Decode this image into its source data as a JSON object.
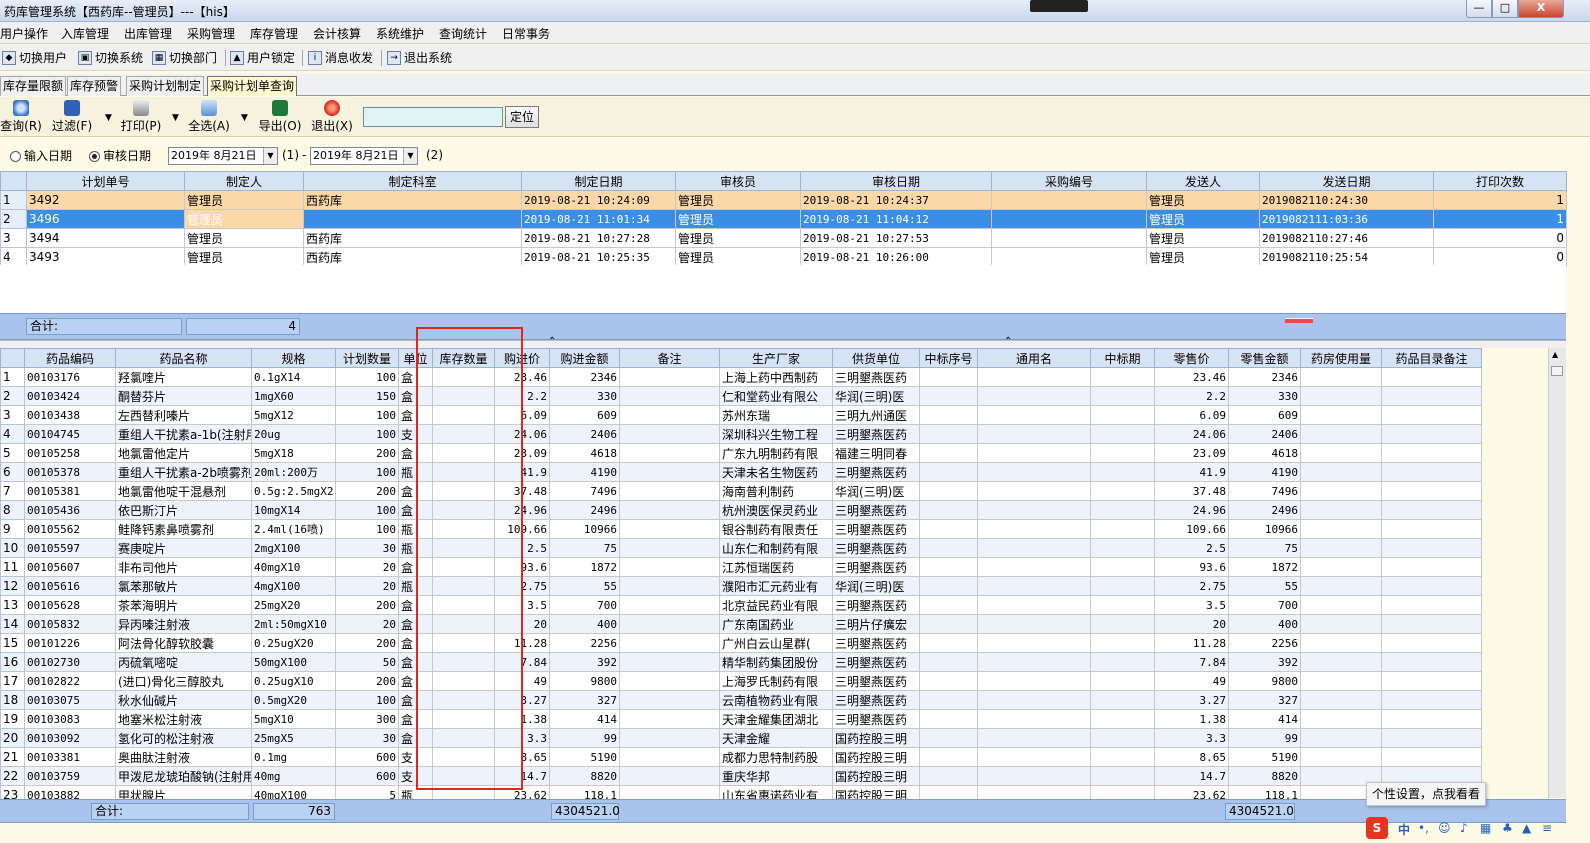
{
  "window": {
    "title": "药库管理系统【西药库--管理员】---【his】",
    "min_label": "—",
    "max_label": "□",
    "close_label": "X"
  },
  "menu": [
    "用户操作",
    "入库管理",
    "出库管理",
    "采购管理",
    "库存管理",
    "会计核算",
    "系统维护",
    "查询统计",
    "日常事务"
  ],
  "quickbar": [
    "切换用户",
    "切换系统",
    "切换部门",
    "用户锁定",
    "消息收发",
    "退出系统"
  ],
  "tabs": [
    "库存量限额",
    "库存预警",
    "采购计划制定",
    "采购计划单查询"
  ],
  "functions": {
    "query": "查询(R)",
    "filter": "过滤(F)",
    "print": "打印(P)",
    "select_all": "全选(A)",
    "export": "导出(O)",
    "exit": "退出(X)",
    "locate_button": "定位",
    "locate_value": ""
  },
  "filter": {
    "input_date_label": "输入日期",
    "audit_date_label": "审核日期",
    "date_from": "2019年 8月21日",
    "label_1": "(1)",
    "separator": "-",
    "date_to": "2019年 8月21日",
    "label_2": "(2)"
  },
  "plans": {
    "headers": [
      "计划单号",
      "制定人",
      "制定科室",
      "制定日期",
      "审核员",
      "审核日期",
      "采购编号",
      "发送人",
      "发送日期",
      "打印次数"
    ],
    "rows": [
      [
        "1",
        "3492",
        "管理员",
        "西药库",
        "2019-08-21 10:24:09",
        "管理员",
        "2019-08-21 10:24:37",
        "",
        "管理员",
        "2019082110:24:30",
        "1"
      ],
      [
        "2",
        "3496",
        "管理员",
        "",
        "2019-08-21 11:01:34",
        "管理员",
        "2019-08-21 11:04:12",
        "",
        "管理员",
        "2019082111:03:36",
        "1"
      ],
      [
        "3",
        "3494",
        "管理员",
        "西药库",
        "2019-08-21 10:27:28",
        "管理员",
        "2019-08-21 10:27:53",
        "",
        "管理员",
        "2019082110:27:46",
        "0"
      ],
      [
        "4",
        "3493",
        "管理员",
        "西药库",
        "2019-08-21 10:25:35",
        "管理员",
        "2019-08-21 10:26:00",
        "",
        "管理员",
        "2019082110:25:54",
        "0"
      ]
    ],
    "summary_label": "合计:",
    "summary_count": "4"
  },
  "details": {
    "headers": [
      "药品编码",
      "药品名称",
      "规格",
      "计划数量",
      "单位",
      "库存数量",
      "购进价",
      "购进金额",
      "备注",
      "生产厂家",
      "供货单位",
      "中标序号",
      "通用名",
      "中标期",
      "零售价",
      "零售金额",
      "药房使用量",
      "药品目录备注"
    ],
    "rows": [
      [
        "1",
        "00103176",
        "羟氯喹片",
        "0.1gX14",
        "100",
        "盒",
        "",
        "23.46",
        "2346",
        "",
        "上海上药中西制药",
        "三明墾燕医药",
        "",
        "",
        "",
        "23.46",
        "2346",
        "",
        ""
      ],
      [
        "2",
        "00103424",
        "酮替芬片",
        "1mgX60",
        "150",
        "盒",
        "",
        "2.2",
        "330",
        "",
        "仁和堂药业有限公",
        "华润(三明)医",
        "",
        "",
        "",
        "2.2",
        "330",
        "",
        ""
      ],
      [
        "3",
        "00103438",
        "左西替利嗪片",
        "5mgX12",
        "100",
        "盒",
        "",
        "6.09",
        "609",
        "",
        "苏州东瑞",
        "三明九州通医",
        "",
        "",
        "",
        "6.09",
        "609",
        "",
        ""
      ],
      [
        "4",
        "00104745",
        "重组人干扰素a-1b(注射用",
        "20ug",
        "100",
        "支",
        "",
        "24.06",
        "2406",
        "",
        "深圳科兴生物工程",
        "三明墾燕医药",
        "",
        "",
        "",
        "24.06",
        "2406",
        "",
        ""
      ],
      [
        "5",
        "00105258",
        "地氯雷他定片",
        "5mgX18",
        "200",
        "盒",
        "",
        "23.09",
        "4618",
        "",
        "广东九明制药有限",
        "福建三明同春",
        "",
        "",
        "",
        "23.09",
        "4618",
        "",
        ""
      ],
      [
        "6",
        "00105378",
        "重组人干扰素a-2b喷雾剂",
        "20ml:200万",
        "100",
        "瓶",
        "",
        "41.9",
        "4190",
        "",
        "天津未名生物医药",
        "三明墾燕医药",
        "",
        "",
        "",
        "41.9",
        "4190",
        "",
        ""
      ],
      [
        "7",
        "00105381",
        "地氯雷他啶干混悬剂",
        "0.5g:2.5mgX2",
        "200",
        "盒",
        "",
        "37.48",
        "7496",
        "",
        "海南普利制药",
        "华润(三明)医",
        "",
        "",
        "",
        "37.48",
        "7496",
        "",
        ""
      ],
      [
        "8",
        "00105436",
        "依巴斯汀片",
        "10mgX14",
        "100",
        "盒",
        "",
        "24.96",
        "2496",
        "",
        "杭州澳医保灵药业",
        "三明墾燕医药",
        "",
        "",
        "",
        "24.96",
        "2496",
        "",
        ""
      ],
      [
        "9",
        "00105562",
        "鲑降钙素鼻喷雾剂",
        "2.4ml(16喷)",
        "100",
        "瓶",
        "",
        "109.66",
        "10966",
        "",
        "银谷制药有限责任",
        "三明墾燕医药",
        "",
        "",
        "",
        "109.66",
        "10966",
        "",
        ""
      ],
      [
        "10",
        "00105597",
        "赛庚啶片",
        "2mgX100",
        "30",
        "瓶",
        "",
        "2.5",
        "75",
        "",
        "山东仁和制药有限",
        "三明墾燕医药",
        "",
        "",
        "",
        "2.5",
        "75",
        "",
        ""
      ],
      [
        "11",
        "00105607",
        "非布司他片",
        "40mgX10",
        "20",
        "盒",
        "",
        "93.6",
        "1872",
        "",
        "江苏恒瑞医药",
        "三明墾燕医药",
        "",
        "",
        "",
        "93.6",
        "1872",
        "",
        ""
      ],
      [
        "12",
        "00105616",
        "氯苯那敏片",
        "4mgX100",
        "20",
        "瓶",
        "",
        "2.75",
        "55",
        "",
        "濮阳市汇元药业有",
        "华润(三明)医",
        "",
        "",
        "",
        "2.75",
        "55",
        "",
        ""
      ],
      [
        "13",
        "00105628",
        "茶苯海明片",
        "25mgX20",
        "200",
        "盒",
        "",
        "3.5",
        "700",
        "",
        "北京益民药业有限",
        "三明墾燕医药",
        "",
        "",
        "",
        "3.5",
        "700",
        "",
        ""
      ],
      [
        "14",
        "00105832",
        "异丙嗪注射液",
        "2ml:50mgX10",
        "20",
        "盒",
        "",
        "20",
        "400",
        "",
        "广东南国药业",
        "三明片仔癀宏",
        "",
        "",
        "",
        "20",
        "400",
        "",
        ""
      ],
      [
        "15",
        "00101226",
        "阿法骨化醇软胶囊",
        "0.25ugX20",
        "200",
        "盒",
        "",
        "11.28",
        "2256",
        "",
        "广州白云山星群(",
        "三明墾燕医药",
        "",
        "",
        "",
        "11.28",
        "2256",
        "",
        ""
      ],
      [
        "16",
        "00102730",
        "丙硫氧嘧啶",
        "50mgX100",
        "50",
        "盒",
        "",
        "7.84",
        "392",
        "",
        "精华制药集团股份",
        "三明墾燕医药",
        "",
        "",
        "",
        "7.84",
        "392",
        "",
        ""
      ],
      [
        "17",
        "00102822",
        "(进口)骨化三醇胶丸",
        "0.25ugX10",
        "200",
        "盒",
        "",
        "49",
        "9800",
        "",
        "上海罗氏制药有限",
        "三明墾燕医药",
        "",
        "",
        "",
        "49",
        "9800",
        "",
        ""
      ],
      [
        "18",
        "00103075",
        "秋水仙碱片",
        "0.5mgX20",
        "100",
        "盒",
        "",
        "3.27",
        "327",
        "",
        "云南植物药业有限",
        "三明墾燕医药",
        "",
        "",
        "",
        "3.27",
        "327",
        "",
        ""
      ],
      [
        "19",
        "00103083",
        "地塞米松注射液",
        "5mgX10",
        "300",
        "盒",
        "",
        "1.38",
        "414",
        "",
        "天津金耀集团湖北",
        "三明墾燕医药",
        "",
        "",
        "",
        "1.38",
        "414",
        "",
        ""
      ],
      [
        "20",
        "00103092",
        "氢化可的松注射液",
        "25mgX5",
        "30",
        "盒",
        "",
        "3.3",
        "99",
        "",
        "天津金耀",
        "国药控股三明",
        "",
        "",
        "",
        "3.3",
        "99",
        "",
        ""
      ],
      [
        "21",
        "00103381",
        "奥曲肽注射液",
        "0.1mg",
        "600",
        "支",
        "",
        "8.65",
        "5190",
        "",
        "成都力思特制药股",
        "国药控股三明",
        "",
        "",
        "",
        "8.65",
        "5190",
        "",
        ""
      ],
      [
        "22",
        "00103759",
        "甲泼尼龙琥珀酸钠(注射用",
        "40mg",
        "600",
        "支",
        "",
        "14.7",
        "8820",
        "",
        "重庆华邦",
        "国药控股三明",
        "",
        "",
        "",
        "14.7",
        "8820",
        "",
        ""
      ],
      [
        "23",
        "00103882",
        "甲状腺片",
        "40mgX100",
        "5",
        "瓶",
        "",
        "23.62",
        "118.1",
        "",
        "山东省惠诺药业有",
        "国药控股三明",
        "",
        "",
        "",
        "23.62",
        "118.1",
        "",
        ""
      ]
    ],
    "summary_label": "合计:",
    "summary_qty": "763",
    "summary_purchase": "4304521.0",
    "summary_retail": "4304521.0"
  },
  "tooltip": "个性设置，点我看看",
  "tray": {
    "ime_logo": "S",
    "lang": "中"
  },
  "colors": {
    "selected_row": "#3a8ee6",
    "highlight_row": "#fbd8a8",
    "header_bg": "#d6e3f5",
    "annotation_box": "#e0261f"
  }
}
